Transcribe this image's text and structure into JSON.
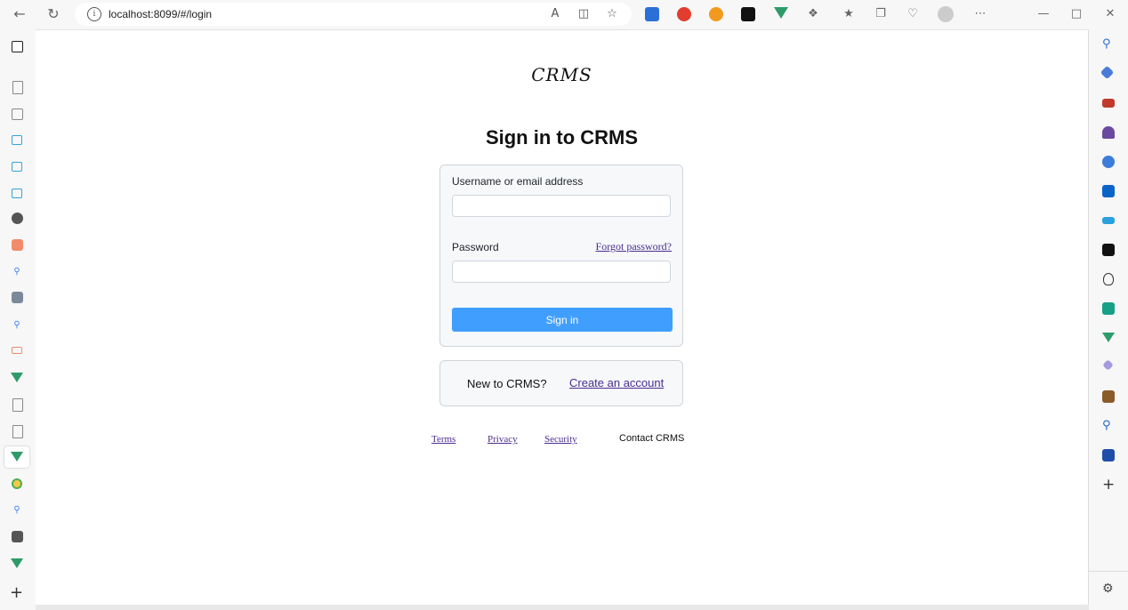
{
  "browser": {
    "url": "localhost:8099/#/login"
  },
  "page": {
    "logo": "CRMS",
    "title": "Sign in to CRMS",
    "login_form": {
      "username_label": "Username or email address",
      "username_value": "",
      "password_label": "Password",
      "password_value": "",
      "forgot_label": "Forgot password?",
      "signin_label": "Sign in"
    },
    "signup": {
      "prompt": "New to CRMS?",
      "link": "Create an account"
    },
    "footer": {
      "terms": "Terms",
      "privacy": "Privacy",
      "security": "Security",
      "contact": "Contact CRMS"
    }
  },
  "colors": {
    "primary_button": "#409eff",
    "link": "#4b2d8f",
    "box_border": "#d0d4d9"
  }
}
